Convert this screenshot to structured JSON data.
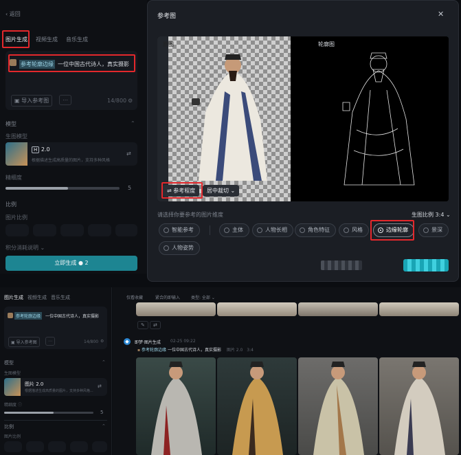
{
  "top": {
    "back_label": "返回",
    "tabs": [
      "图片生成",
      "视频生成",
      "音乐生成"
    ],
    "prompt_tag": "参考轮廓边缘",
    "prompt_text": "一位中国古代诗人，真实摄影",
    "import_label": "导入参考图",
    "char_count": "14/800",
    "model_section": "模型",
    "main_model_label": "生图模型",
    "model_name": "2.0",
    "model_desc": "根据描述生成高质量的图片，支持多种风格",
    "precision_label": "精细度",
    "precision_value": "5",
    "precision_fraction": 0.55,
    "ratio_section": "比例",
    "ratio_sub": "图片比例",
    "seed_label": "积分消耗说明",
    "generate_label": "立即生成",
    "generate_count": "2"
  },
  "modal": {
    "title": "参考图",
    "close_icon": "close-icon",
    "original_label": "原图",
    "outline_label": "轮廓图",
    "ref_degree_label": "参考程度",
    "crop_label": "居中裁切",
    "choose_label": "请选择你要参考的图片维度",
    "ratio_label": "生图比例",
    "ratio_value": "3:4",
    "options": [
      "智能参考",
      "主体",
      "人物长相",
      "角色特征",
      "风格",
      "边缘轮廓",
      "景深",
      "人物姿势"
    ],
    "selected_option": "边缘轮廓"
  },
  "bottom": {
    "tabs": [
      "图片生成",
      "视频生成",
      "音乐生成"
    ],
    "prompt_tag": "参考轮廓边缘",
    "prompt_text": "一位中国古代诗人，真实摄影",
    "import_label": "导入参考图",
    "char_count": "14/800",
    "model_section": "模型",
    "main_model_label": "生图模型",
    "model_name": "图片 2.0",
    "model_desc": "根据描述生成高质量的图片，支持多种风格...",
    "precision_label": "精细度",
    "precision_value": "5",
    "precision_fraction": 0.55,
    "ratio_section": "比例",
    "ratio_sub": "图片比例",
    "filters": [
      "仅看收藏",
      "紧合的即输入",
      "类型: 全部"
    ],
    "history_title": "即梦·图片生成",
    "history_time": "02-25  09:22",
    "history_tag": "参考轮廓边缘",
    "history_prompt": "一位中国古代诗人，真实摄影",
    "history_model": "图片 2.0",
    "history_ratio": "3:4"
  }
}
